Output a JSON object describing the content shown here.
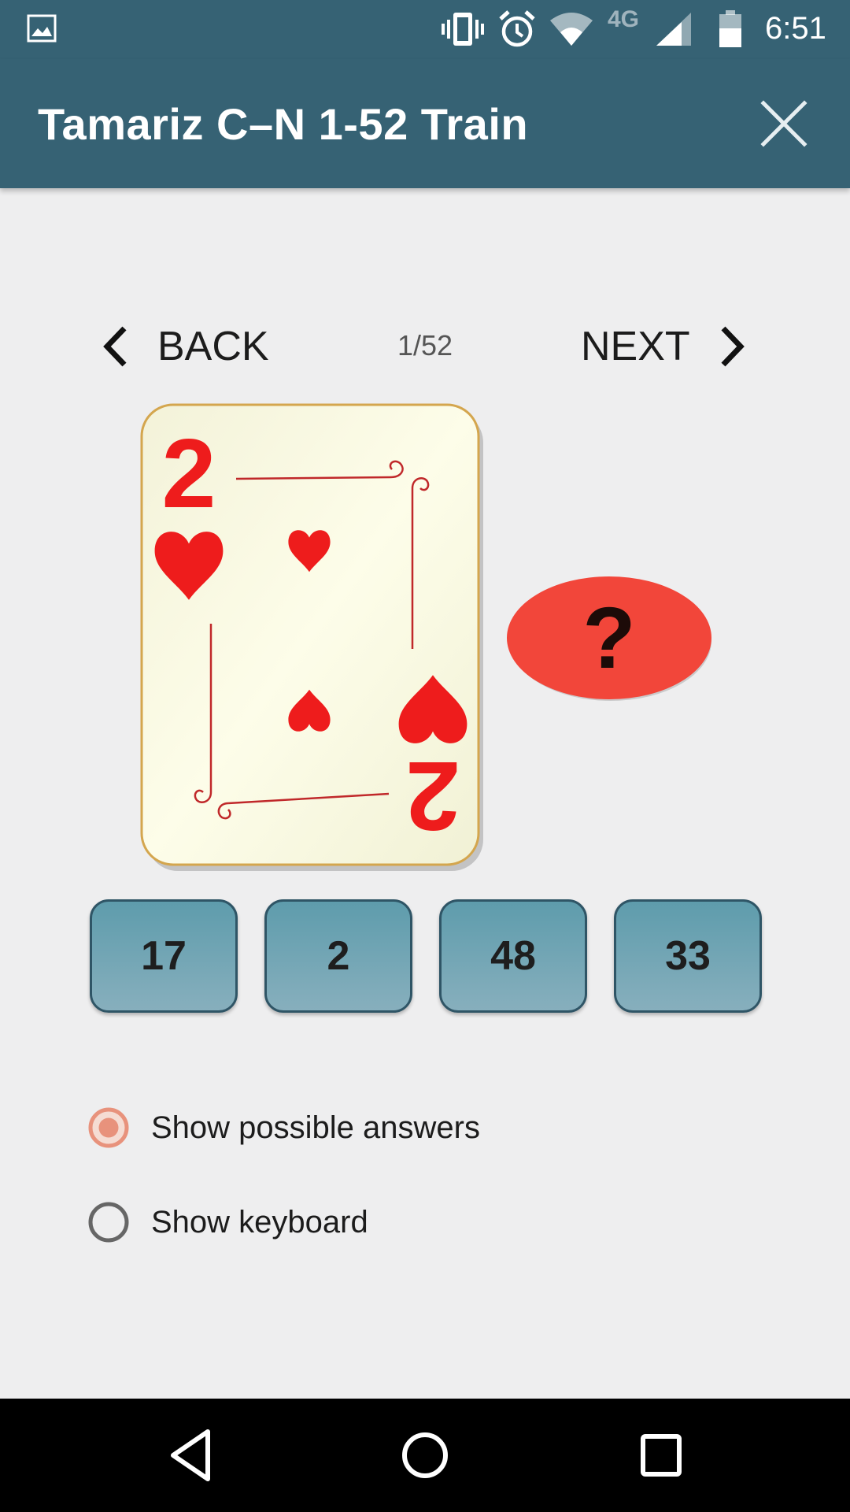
{
  "status_bar": {
    "network_type": "4G",
    "time": "6:51"
  },
  "app_bar": {
    "title": "Tamariz C–N 1-52 Train"
  },
  "navigation": {
    "back_label": "BACK",
    "next_label": "NEXT",
    "page_indicator": "1/52"
  },
  "card": {
    "rank": "2",
    "suit": "hearts",
    "color": "#ee1c1c"
  },
  "question_mark": "?",
  "answers": [
    "17",
    "2",
    "48",
    "33"
  ],
  "options": [
    {
      "label": "Show possible answers",
      "selected": true
    },
    {
      "label": "Show keyboard",
      "selected": false
    }
  ],
  "colors": {
    "primary": "#366274",
    "accent": "#e8927c",
    "bubble": "#f2463a",
    "answer_button": "#7aa9b8"
  }
}
